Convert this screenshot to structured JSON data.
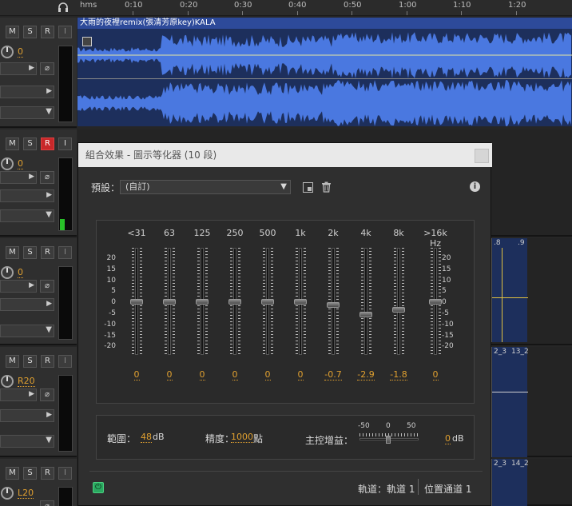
{
  "ruler": {
    "unit": "hms",
    "ticks": [
      "0:10",
      "0:20",
      "0:30",
      "0:40",
      "0:50",
      "1:00",
      "1:10",
      "1:20"
    ]
  },
  "tracks": [
    {
      "mute": "M",
      "solo": "S",
      "record": "R",
      "input": "I",
      "volume": "0",
      "record_armed": false
    },
    {
      "mute": "M",
      "solo": "S",
      "record": "R",
      "input": "I",
      "volume": "0",
      "record_armed": true
    },
    {
      "mute": "M",
      "solo": "S",
      "record": "R",
      "input": "I",
      "volume": "0",
      "record_armed": false
    },
    {
      "mute": "M",
      "solo": "S",
      "record": "R",
      "input": "I",
      "volume": "R20",
      "record_armed": false
    },
    {
      "mute": "M",
      "solo": "S",
      "record": "R",
      "input": "I",
      "volume": "L20",
      "record_armed": false
    }
  ],
  "clip": {
    "title": "大雨的夜裡remix(張清芳原key)KALA",
    "color": "#2d4a9a",
    "wave_color": "#4a78e0"
  },
  "right_clips": {
    "c1_labels": [
      ".8",
      ".9"
    ],
    "c2_labels": [
      "2_3",
      "13_2"
    ],
    "c3_labels": [
      "2_3",
      "14_2"
    ]
  },
  "dialog": {
    "title": "組合效果 - 圖示等化器 (10 段)",
    "preset_label": "預設：",
    "preset_value": "(自訂)",
    "scale": [
      "20",
      "15",
      "10",
      "5",
      "0",
      "-5",
      "-10",
      "-15",
      "-20"
    ],
    "bands": [
      {
        "label": "<31",
        "value": "0"
      },
      {
        "label": "63",
        "value": "0"
      },
      {
        "label": "125",
        "value": "0"
      },
      {
        "label": "250",
        "value": "0"
      },
      {
        "label": "500",
        "value": "0"
      },
      {
        "label": "1k",
        "value": "0"
      },
      {
        "label": "2k",
        "value": "-0.7"
      },
      {
        "label": "4k",
        "value": "-2.9"
      },
      {
        "label": "8k",
        "value": "-1.8"
      },
      {
        "label": ">16k Hz",
        "value": "0"
      }
    ],
    "range_label": "範圍：",
    "range_value": "48",
    "range_unit": "dB",
    "accuracy_label": "精度：",
    "accuracy_value": "1000",
    "accuracy_unit": "點",
    "master_gain_label": "主控增益：",
    "master_gain_min": "-50",
    "master_gain_mid": "0",
    "master_gain_max": "50",
    "master_gain_value": "0",
    "master_gain_unit": "dB",
    "channel_text": "軌道：軌道 1",
    "position_text": "位置通道 1"
  }
}
